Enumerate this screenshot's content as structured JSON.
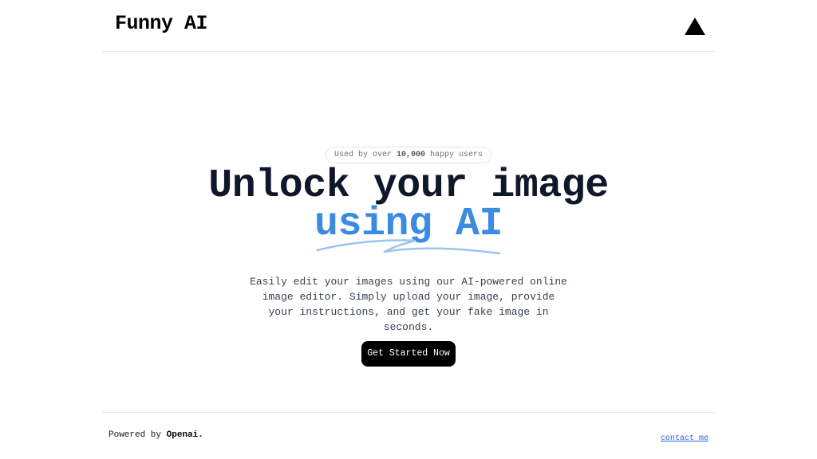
{
  "header": {
    "brand": "Funny AI",
    "logo_icon": "triangle-icon"
  },
  "hero": {
    "badge": {
      "prefix": "Used by over",
      "count": "10,000",
      "suffix": "happy users"
    },
    "headline_line1": "Unlock your image",
    "headline_accent": "using AI",
    "description": "Easily edit your images using our AI-powered online image editor. Simply upload your image, provide your instructions, and get your fake image in seconds.",
    "cta_label": "Get Started Now"
  },
  "footer": {
    "powered_prefix": "Powered by",
    "powered_brand": "Openai.",
    "contact_label": "contact me"
  },
  "colors": {
    "accent": "#3b8be0",
    "text_dark": "#0f172a",
    "button_bg": "#000000",
    "link": "#2563eb"
  }
}
